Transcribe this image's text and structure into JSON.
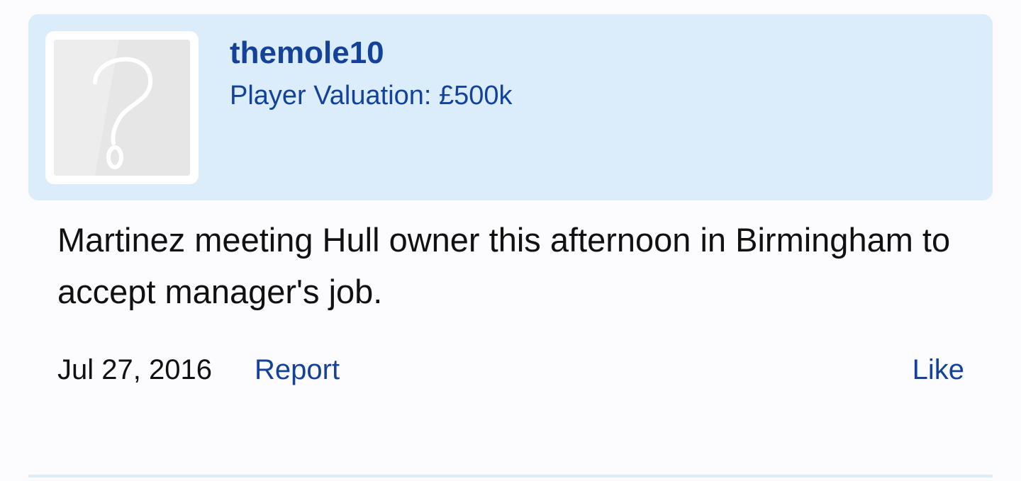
{
  "post": {
    "author": {
      "username": "themole10",
      "valuation": "Player Valuation: £500k",
      "avatar_icon": "question-mark-icon"
    },
    "body": "Martinez meeting Hull owner this afternoon in Birmingham to accept manager's job.",
    "date": "Jul 27, 2016",
    "report_label": "Report",
    "like_label": "Like"
  },
  "colors": {
    "accent": "#14429a",
    "header_background": "#dbedfa",
    "page_background": "#fcfcff",
    "text": "#111111"
  }
}
